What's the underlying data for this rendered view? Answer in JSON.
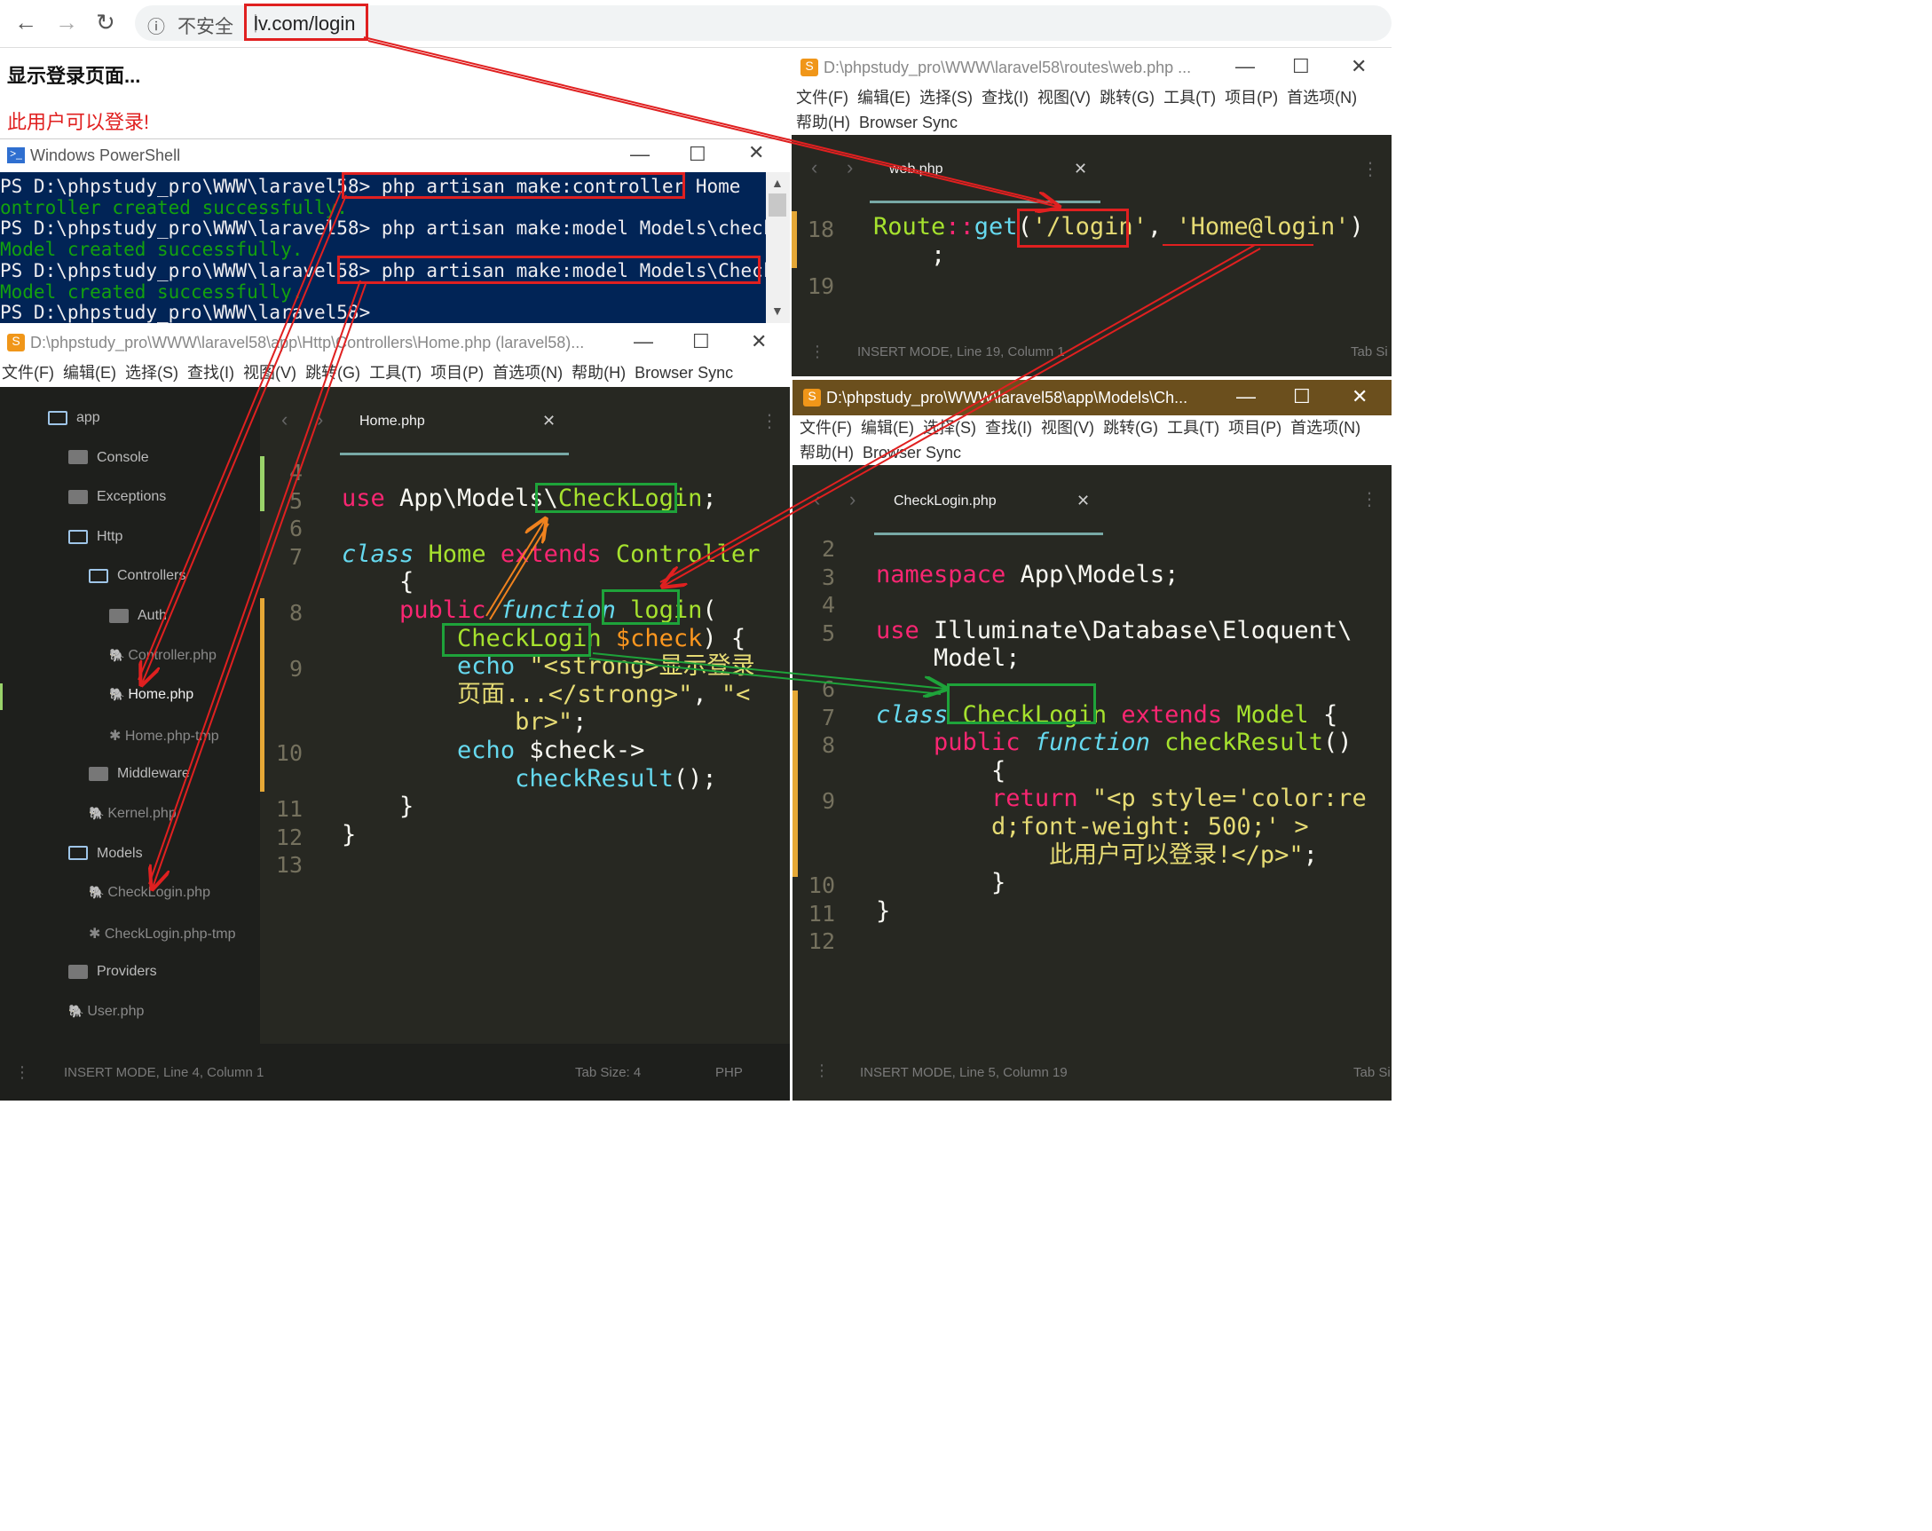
{
  "browser": {
    "security": "不安全",
    "url": "lv.com/login",
    "heading": "显示登录页面...",
    "message": "此用户可以登录!",
    "message_color": "#e02020"
  },
  "powershell": {
    "title": "Windows PowerShell",
    "lines": [
      {
        "t": "PS D:\\phpstudy_pro\\WWW\\laravel58> php artisan make:controller Home",
        "c": "pw"
      },
      {
        "t": "ontroller created successfully.",
        "c": "pg"
      },
      {
        "t": "PS D:\\phpstudy_pro\\WWW\\laravel58> php artisan make:model Models\\checkLogin",
        "c": "pw"
      },
      {
        "t": "Model created successfully.",
        "c": "pg"
      },
      {
        "t": "PS D:\\phpstudy_pro\\WWW\\laravel58> php artisan make:model Models\\CheckLogin",
        "c": "pw"
      },
      {
        "t": "Model created successfully.",
        "c": "pg"
      },
      {
        "t": "PS D:\\phpstudy_pro\\WWW\\laravel58>",
        "c": "pw"
      }
    ]
  },
  "menu": {
    "file": "文件(F)",
    "edit": "编辑(E)",
    "select": "选择(S)",
    "find": "查找(I)",
    "view": "视图(V)",
    "goto": "跳转(G)",
    "tools": "工具(T)",
    "project": "项目(P)",
    "prefs": "首选项(N)",
    "help": "帮助(H)",
    "sync": "Browser Sync"
  },
  "routes": {
    "title": "D:\\phpstudy_pro\\WWW\\laravel58\\routes\\web.php ...",
    "tab": "web.php",
    "lines": [
      {
        "n": "18",
        "code": [
          [
            "cls",
            "Route"
          ],
          [
            "op",
            "::"
          ],
          [
            "kw",
            "get"
          ],
          [
            "pl",
            "("
          ],
          [
            "st",
            "'/login'"
          ],
          [
            "pl",
            ", "
          ],
          [
            "st",
            "'Home@login'"
          ],
          [
            "pl",
            ")"
          ]
        ]
      },
      {
        "n": "",
        "code": [
          [
            "pl",
            "    ;"
          ]
        ]
      },
      {
        "n": "19",
        "code": []
      }
    ],
    "status": "INSERT MODE, Line 19, Column 1",
    "tabsize": "Tab Si"
  },
  "home": {
    "title": "D:\\phpstudy_pro\\WWW\\laravel58\\app\\Http\\Controllers\\Home.php (laravel58)...",
    "tab": "Home.php",
    "sidebar": [
      {
        "label": "app",
        "indent": 0,
        "type": "folder"
      },
      {
        "label": "Console",
        "indent": 1,
        "type": "dir"
      },
      {
        "label": "Exceptions",
        "indent": 1,
        "type": "dir"
      },
      {
        "label": "Http",
        "indent": 1,
        "type": "folder"
      },
      {
        "label": "Controllers",
        "indent": 2,
        "type": "folder"
      },
      {
        "label": "Auth",
        "indent": 3,
        "type": "dir"
      },
      {
        "label": "Controller.php",
        "indent": 3,
        "type": "php"
      },
      {
        "label": "Home.php",
        "indent": 3,
        "type": "php-active"
      },
      {
        "label": "Home.php-tmp",
        "indent": 3,
        "type": "tmp"
      },
      {
        "label": "Middleware",
        "indent": 2,
        "type": "dir"
      },
      {
        "label": "Kernel.php",
        "indent": 2,
        "type": "php"
      },
      {
        "label": "Models",
        "indent": 1,
        "type": "folder"
      },
      {
        "label": "CheckLogin.php",
        "indent": 2,
        "type": "php"
      },
      {
        "label": "CheckLogin.php-tmp",
        "indent": 2,
        "type": "tmp"
      },
      {
        "label": "Providers",
        "indent": 1,
        "type": "dir"
      },
      {
        "label": "User.php",
        "indent": 1,
        "type": "php"
      }
    ],
    "lines": [
      {
        "n": "4",
        "code": []
      },
      {
        "n": "5",
        "code": [
          [
            "op",
            "use "
          ],
          [
            "pl",
            "App\\Models\\"
          ],
          [
            "cls",
            "CheckLogin"
          ],
          [
            "pl",
            ";"
          ]
        ]
      },
      {
        "n": "6",
        "code": []
      },
      {
        "n": "7",
        "code": [
          [
            "it",
            "class "
          ],
          [
            "cls",
            "Home "
          ],
          [
            "op",
            "extends "
          ],
          [
            "cls",
            "Controller"
          ]
        ]
      },
      {
        "n": "",
        "code": [
          [
            "pl",
            "    {"
          ]
        ]
      },
      {
        "n": "8",
        "code": [
          [
            "pl",
            "    "
          ],
          [
            "op",
            "public "
          ],
          [
            "it",
            "function "
          ],
          [
            "cls",
            "login"
          ],
          [
            "pl",
            "("
          ]
        ]
      },
      {
        "n": "",
        "code": [
          [
            "pl",
            "        "
          ],
          [
            "cls",
            "CheckLogin "
          ],
          [
            "va",
            "$check"
          ],
          [
            "pl",
            ") {"
          ]
        ]
      },
      {
        "n": "9",
        "code": [
          [
            "pl",
            "        "
          ],
          [
            "kw",
            "echo "
          ],
          [
            "st",
            "\"<strong>显示登录"
          ]
        ]
      },
      {
        "n": "",
        "code": [
          [
            "st",
            "        页面...</strong>\""
          ],
          [
            "pl",
            ", "
          ],
          [
            "st",
            "\"<"
          ]
        ]
      },
      {
        "n": "",
        "code": [
          [
            "st",
            "            br>\""
          ],
          [
            "pl",
            ";"
          ]
        ]
      },
      {
        "n": "10",
        "code": [
          [
            "pl",
            "        "
          ],
          [
            "kw",
            "echo "
          ],
          [
            "pl",
            "$check->"
          ]
        ]
      },
      {
        "n": "",
        "code": [
          [
            "pl",
            "            "
          ],
          [
            "kw",
            "checkResult"
          ],
          [
            "pl",
            "();"
          ]
        ]
      },
      {
        "n": "11",
        "code": [
          [
            "pl",
            "    }"
          ]
        ]
      },
      {
        "n": "12",
        "code": [
          [
            "pl",
            "}"
          ]
        ]
      },
      {
        "n": "13",
        "code": []
      }
    ],
    "status": "INSERT MODE, Line 4, Column 1",
    "tabsize": "Tab Size: 4",
    "lang": "PHP"
  },
  "model": {
    "title": "D:\\phpstudy_pro\\WWW\\laravel58\\app\\Models\\Ch...",
    "tab": "CheckLogin.php",
    "lines": [
      {
        "n": "2",
        "code": []
      },
      {
        "n": "3",
        "code": [
          [
            "op",
            "namespace "
          ],
          [
            "pl",
            "App\\Models;"
          ]
        ]
      },
      {
        "n": "4",
        "code": []
      },
      {
        "n": "5",
        "code": [
          [
            "op",
            "use "
          ],
          [
            "pl",
            "Illuminate\\Database\\Eloquent\\"
          ]
        ]
      },
      {
        "n": "",
        "code": [
          [
            "pl",
            "    Model;"
          ]
        ]
      },
      {
        "n": "6",
        "code": []
      },
      {
        "n": "7",
        "code": [
          [
            "it",
            "class "
          ],
          [
            "cls",
            "CheckLogin "
          ],
          [
            "op",
            "extends "
          ],
          [
            "cls",
            "Model "
          ],
          [
            "pl",
            "{"
          ]
        ]
      },
      {
        "n": "8",
        "code": [
          [
            "pl",
            "    "
          ],
          [
            "op",
            "public "
          ],
          [
            "it",
            "function "
          ],
          [
            "cls",
            "checkResult"
          ],
          [
            "pl",
            "()"
          ]
        ]
      },
      {
        "n": "",
        "code": [
          [
            "pl",
            "        {"
          ]
        ]
      },
      {
        "n": "9",
        "code": [
          [
            "pl",
            "        "
          ],
          [
            "op",
            "return "
          ],
          [
            "st",
            "\"<p style='color:re"
          ]
        ]
      },
      {
        "n": "",
        "code": [
          [
            "st",
            "        d;font-weight: 500;' >"
          ]
        ]
      },
      {
        "n": "",
        "code": [
          [
            "st",
            "            此用户可以登录!</p>\""
          ],
          [
            "pl",
            ";"
          ]
        ]
      },
      {
        "n": "10",
        "code": [
          [
            "pl",
            "        }"
          ]
        ]
      },
      {
        "n": "11",
        "code": [
          [
            "pl",
            "}"
          ]
        ]
      },
      {
        "n": "12",
        "code": []
      }
    ],
    "status": "INSERT MODE, Line 5, Column 19",
    "tabsize": "Tab Si"
  }
}
